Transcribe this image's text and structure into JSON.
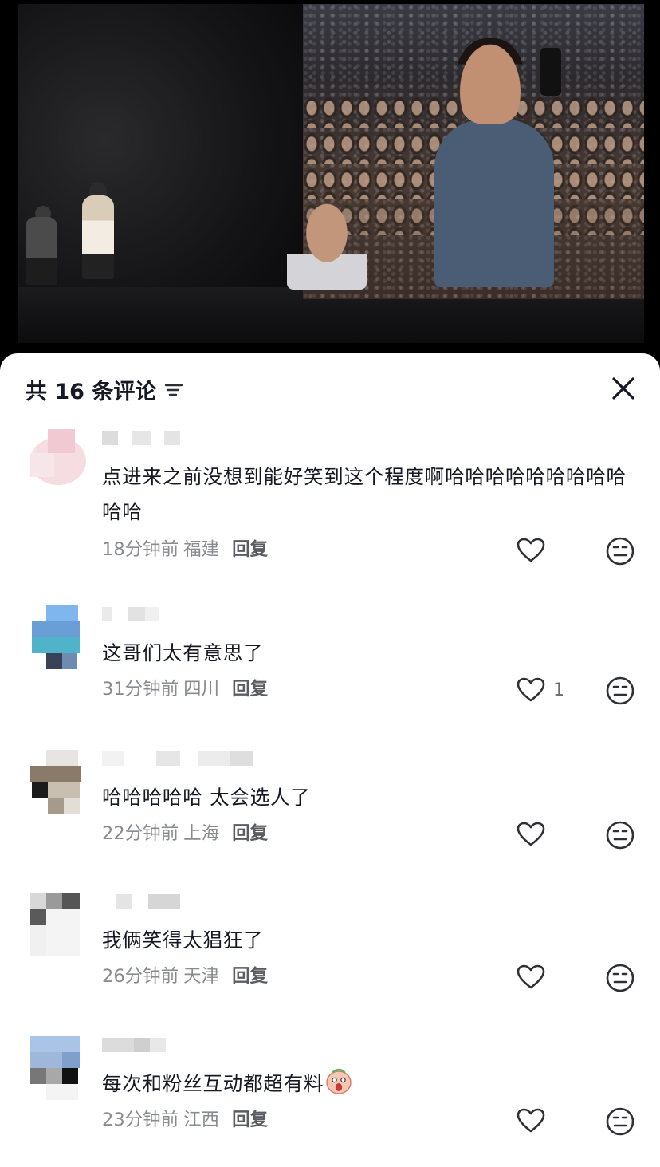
{
  "comments_header": {
    "title": "共 16 条评论"
  },
  "comments": [
    {
      "text": "点进来之前没想到能好笑到这个程度啊哈哈哈哈哈哈哈哈哈哈哈",
      "time": "18分钟前",
      "location": "福建",
      "reply_label": "回复",
      "like_count": ""
    },
    {
      "text": "这哥们太有意思了",
      "time": "31分钟前",
      "location": "四川",
      "reply_label": "回复",
      "like_count": "1"
    },
    {
      "text": "哈哈哈哈哈 太会选人了",
      "time": "22分钟前",
      "location": "上海",
      "reply_label": "回复",
      "like_count": ""
    },
    {
      "text": "我俩笑得太猖狂了",
      "time": "26分钟前",
      "location": "天津",
      "reply_label": "回复",
      "like_count": ""
    },
    {
      "text": "每次和粉丝互动都超有料",
      "time": "23分钟前",
      "location": "江西",
      "reply_label": "回复",
      "like_count": "",
      "emoji": "shocked-face-emoji"
    }
  ],
  "icons": {
    "sort": "sort-lines-icon",
    "close": "close-icon",
    "like": "heart-outline-icon",
    "dislike": "neutral-face-icon"
  },
  "colors": {
    "text_primary": "#161823",
    "text_secondary": "#8a8b91",
    "icon": "#2f3035"
  }
}
